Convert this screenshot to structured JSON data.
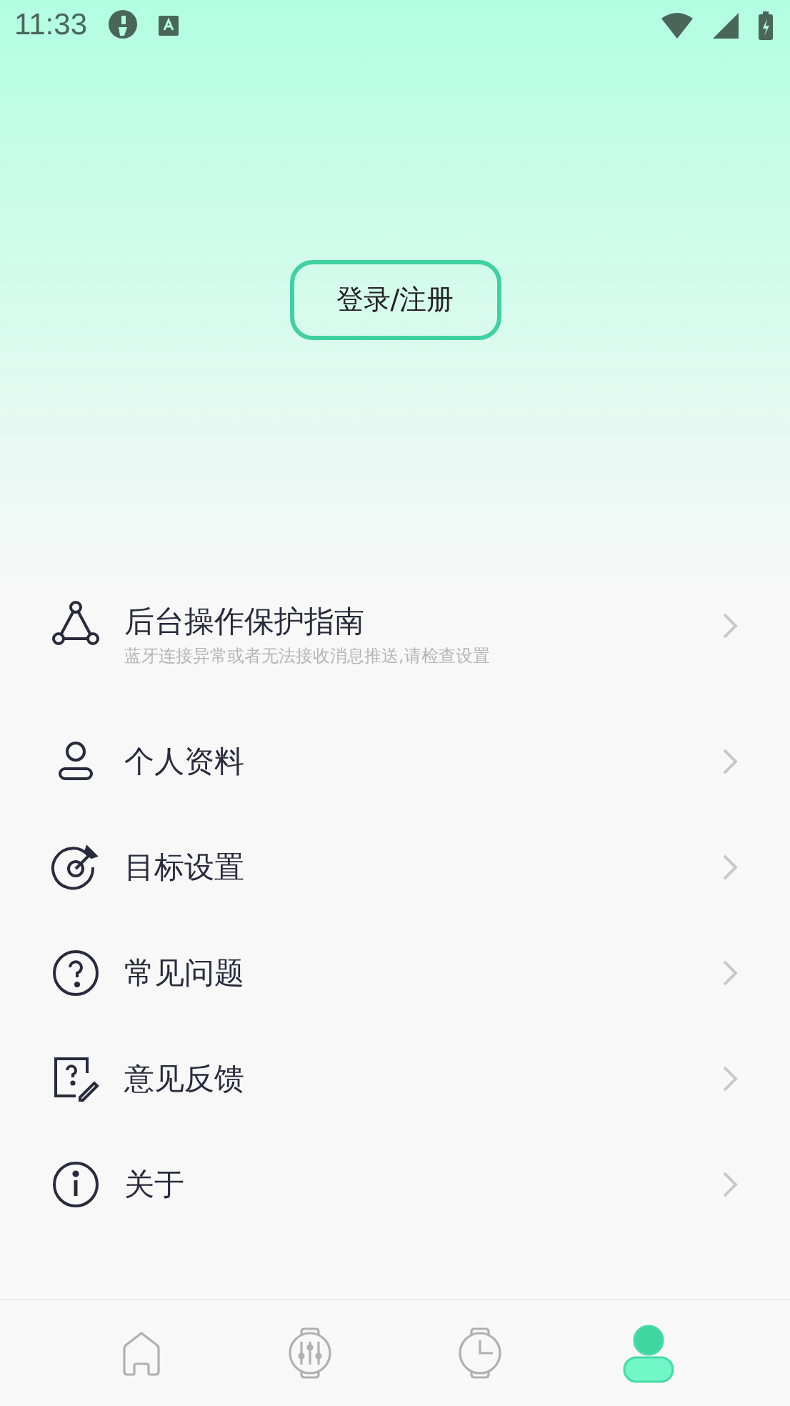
{
  "status_bar": {
    "time": "11:33"
  },
  "login_button": "登录/注册",
  "menu": [
    {
      "kind": "triangle",
      "title": "后台操作保护指南",
      "subtitle": "蓝牙连接异常或者无法接收消息推送,请检查设置"
    },
    {
      "kind": "person",
      "title": "个人资料"
    },
    {
      "kind": "target",
      "title": "目标设置"
    },
    {
      "kind": "question",
      "title": "常见问题"
    },
    {
      "kind": "feedback",
      "title": "意见反馈"
    },
    {
      "kind": "info",
      "title": "关于"
    }
  ],
  "tabs": [
    {
      "kind": "home",
      "selected": false
    },
    {
      "kind": "watch-sliders",
      "selected": false
    },
    {
      "kind": "watch-clock",
      "selected": false
    },
    {
      "kind": "profile",
      "selected": true
    }
  ]
}
